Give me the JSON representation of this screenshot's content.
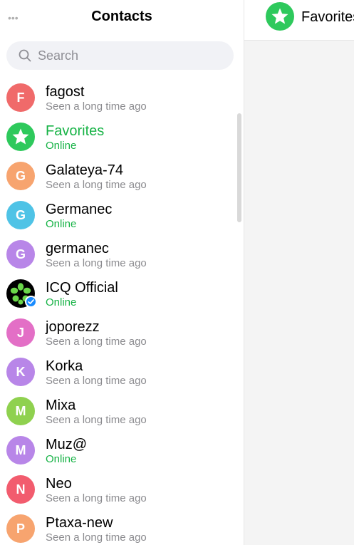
{
  "sidebar": {
    "title": "Contacts",
    "menu_icon": "more-dots-icon",
    "search": {
      "placeholder": "Search",
      "value": ""
    },
    "contacts": [
      {
        "initial": "F",
        "name": "fagost",
        "status": "Seen a long time ago",
        "online": false,
        "color": "#f06a6a"
      },
      {
        "icon": "star-icon",
        "name": "Favorites",
        "status": "Online",
        "online": true,
        "color": "#2ec95c"
      },
      {
        "initial": "G",
        "name": "Galateya-74",
        "status": "Seen a long time ago",
        "online": false,
        "color": "#f7a46f"
      },
      {
        "initial": "G",
        "name": "Germanec",
        "status": "Online",
        "online": true,
        "color": "#4fc3e6"
      },
      {
        "initial": "G",
        "name": "germanec",
        "status": "Seen a long time ago",
        "online": false,
        "color": "#b886e8"
      },
      {
        "icon": "icq-flower-icon",
        "name": "ICQ Official",
        "status": "Online",
        "online": true,
        "color": "#000000",
        "verified": true
      },
      {
        "initial": "J",
        "name": "joporezz",
        "status": "Seen a long time ago",
        "online": false,
        "color": "#e36fc6"
      },
      {
        "initial": "K",
        "name": "Korka",
        "status": "Seen a long time ago",
        "online": false,
        "color": "#b886e8"
      },
      {
        "initial": "M",
        "name": "Mixa",
        "status": "Seen a long time ago",
        "online": false,
        "color": "#8fd14f"
      },
      {
        "initial": "M",
        "name": "Muz@",
        "status": "Online",
        "online": true,
        "color": "#b886e8"
      },
      {
        "initial": "N",
        "name": "Neo",
        "status": "Seen a long time ago",
        "online": false,
        "color": "#f25c6e"
      },
      {
        "initial": "P",
        "name": "Ptaxa-new",
        "status": "Seen a long time ago",
        "online": false,
        "color": "#f7a46f"
      }
    ]
  },
  "chat": {
    "title": "Favorites",
    "avatar_icon": "star-icon",
    "avatar_color": "#2ec95c"
  },
  "colors": {
    "online_text": "#17b346",
    "offline_text": "#8b8b8f",
    "verified_badge": "#1a8cff"
  }
}
